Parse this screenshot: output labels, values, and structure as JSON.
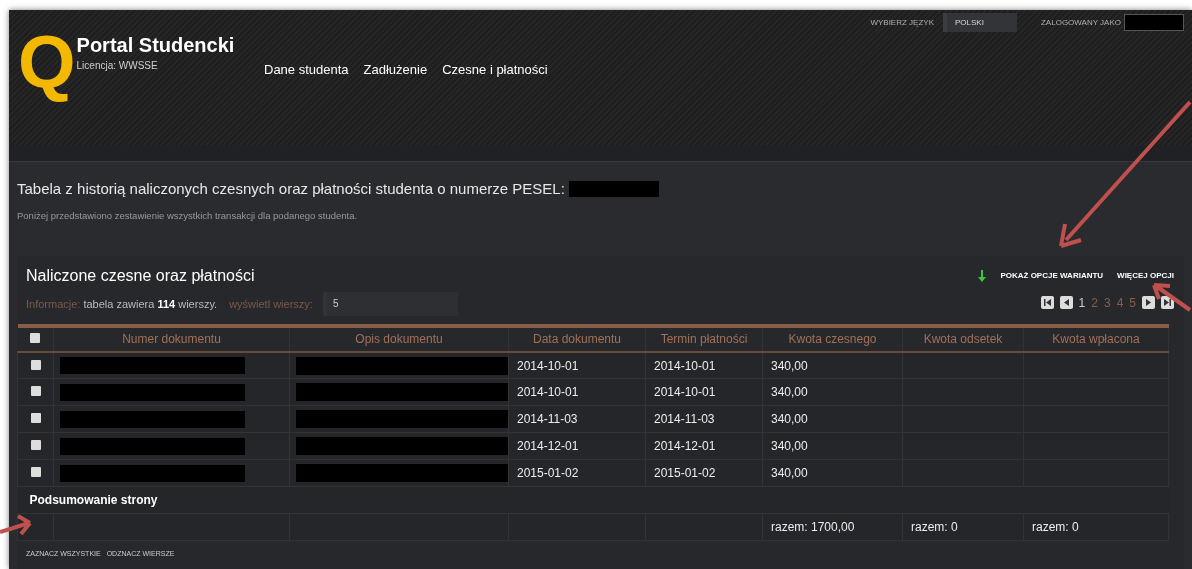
{
  "header": {
    "logo_letter": "Q",
    "title": "Portal Studencki",
    "license": "Licencja: WWSSE",
    "nav": [
      {
        "label": "Dane studenta"
      },
      {
        "label": "Zadłużenie"
      },
      {
        "label": "Czesne i płatności"
      }
    ],
    "language_label": "WYBIERZ JĘZYK",
    "language": "POLSKI",
    "logged_in_label": "ZALOGOWANY JAKO"
  },
  "intro": {
    "heading": "Tabela z historią naliczonych czesnych oraz płatności studenta o numerze PESEL:",
    "subtext": "Poniżej przedstawiono zestawienie wszystkich transakcji dla podanego studenta."
  },
  "panel": {
    "title": "Naliczone czesne oraz płatności",
    "info_label": "Informacje:",
    "info_text": "tabela zawiera **114** wierszy.",
    "rows_label": "wyświetl wierszy:",
    "rows_value": "5",
    "actions": [
      "POKAŻ OPCJE WARIANTU",
      "WIĘCEJ OPCJI"
    ],
    "pages": [
      {
        "label": "1",
        "selected": true
      },
      {
        "label": "2",
        "selected": false
      },
      {
        "label": "3",
        "selected": false
      },
      {
        "label": "4",
        "selected": false
      },
      {
        "label": "5",
        "selected": false
      }
    ]
  },
  "table": {
    "columns": [
      "Numer dokumentu",
      "Opis dokumentu",
      "Data dokumentu",
      "Termin płatności",
      "Kwota czesnego",
      "Kwota odsetek",
      "Kwota wpłacona"
    ],
    "header_checked": false,
    "rows": [
      {
        "checked": false,
        "data_dokumentu": "2014-10-01",
        "termin": "2014-10-01",
        "kwota_czesnego": "340,00"
      },
      {
        "checked": false,
        "data_dokumentu": "2014-10-01",
        "termin": "2014-10-01",
        "kwota_czesnego": "340,00"
      },
      {
        "checked": false,
        "data_dokumentu": "2014-11-03",
        "termin": "2014-11-03",
        "kwota_czesnego": "340,00"
      },
      {
        "checked": false,
        "data_dokumentu": "2014-12-01",
        "termin": "2014-12-01",
        "kwota_czesnego": "340,00"
      },
      {
        "checked": false,
        "data_dokumentu": "2015-01-02",
        "termin": "2015-01-02",
        "kwota_czesnego": "340,00"
      }
    ],
    "summary_label": "Podsumowanie strony",
    "totals": [
      "razem: 1700,00",
      "razem: 0",
      "razem: 0"
    ]
  },
  "footer_links": [
    "ZAZNACZ WSZYSTKIE",
    "ODZNACZ WIERSZE"
  ]
}
